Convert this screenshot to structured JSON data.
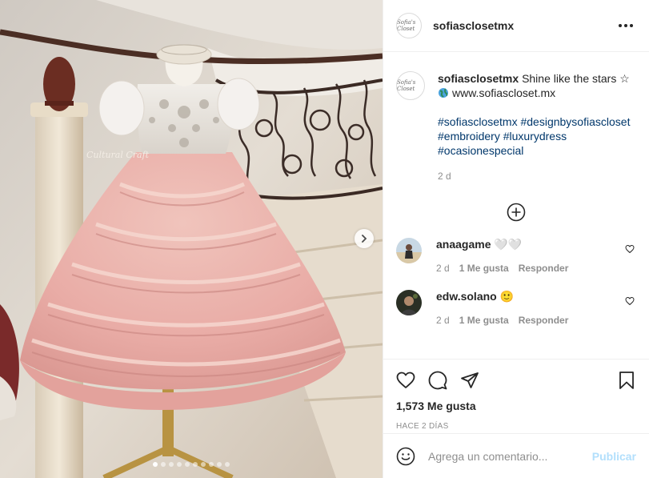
{
  "post": {
    "username": "sofiasclosetmx",
    "avatar_text": "Sofia's Closet",
    "photo_watermark": "Cultural Craft",
    "carousel": {
      "count": 10,
      "active_index": 0
    },
    "caption": {
      "username": "sofiasclosetmx",
      "text": "Shine like the stars ☆",
      "link": "www.sofiascloset.mx",
      "hashtags": [
        "#sofiasclosetmx",
        "#designbysofiascloset",
        "#embroidery",
        "#luxurydress",
        "#ocasionespecial"
      ],
      "time": "2 d"
    },
    "comments": [
      {
        "username": "anaagame",
        "text": "🤍🤍",
        "time": "2 d",
        "likes": "1 Me gusta",
        "reply": "Responder"
      },
      {
        "username": "edw.solano",
        "text": "🙂",
        "time": "2 d",
        "likes": "1 Me gusta",
        "reply": "Responder"
      }
    ],
    "likes_count": "1,573 Me gusta",
    "posted_ago": "HACE 2 DÍAS",
    "add_comment": {
      "placeholder": "Agrega un comentario...",
      "publish_label": "Publicar"
    }
  },
  "colors": {
    "hashtag": "#00376b",
    "secondary_text": "#8e8e8e",
    "publish_disabled": "#b2dffc",
    "border": "#efefef"
  },
  "icons": {
    "more": "more-options-icon",
    "next": "chevron-right-icon",
    "globe": "globe-icon",
    "load_more": "plus-circle-icon",
    "like": "heart-icon",
    "comment": "comment-icon",
    "share": "paper-plane-icon",
    "save": "bookmark-icon",
    "emoji": "smiley-icon"
  }
}
